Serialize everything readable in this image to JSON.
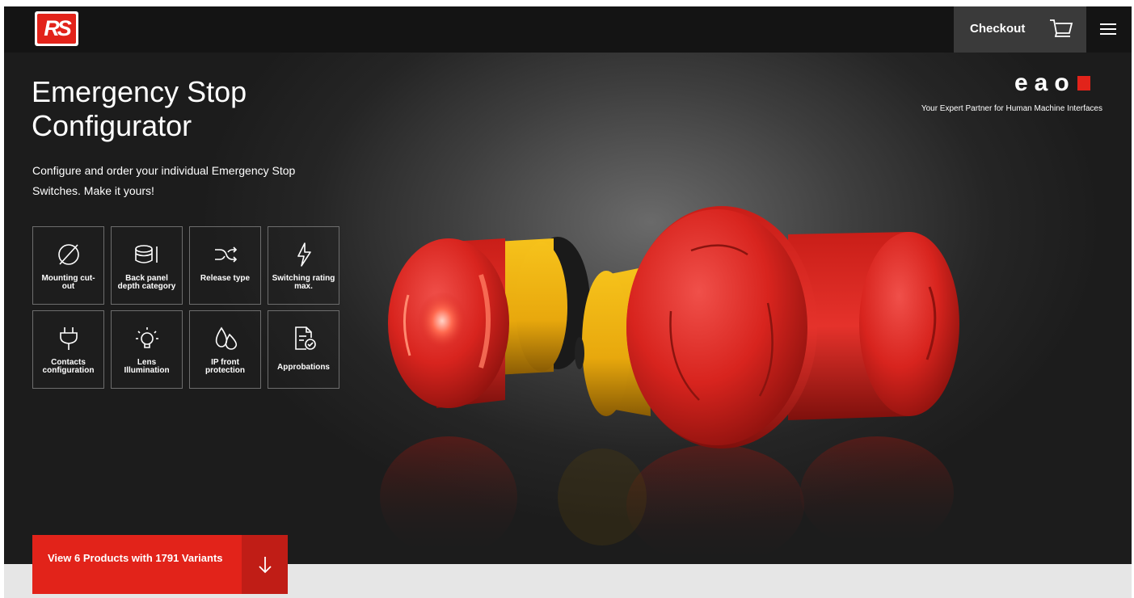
{
  "header": {
    "logo_text": "RS",
    "checkout_label": "Checkout",
    "icons": [
      "cart-icon",
      "hamburger-menu-icon"
    ]
  },
  "hero": {
    "title_line1": "Emergency Stop",
    "title_line2": "Configurator",
    "subtitle": "Configure and order your individual Emergency Stop Switches. Make it yours!",
    "features": [
      {
        "label": "Mounting cut-out",
        "icon": "diameter-icon"
      },
      {
        "label": "Back panel depth category",
        "icon": "cylinder-depth-icon"
      },
      {
        "label": "Release type",
        "icon": "shuffle-icon"
      },
      {
        "label": "Switching rating max.",
        "icon": "lightning-icon"
      },
      {
        "label": "Contacts configuration",
        "icon": "plug-icon"
      },
      {
        "label": "Lens Illumination",
        "icon": "lightbulb-icon"
      },
      {
        "label": "IP front protection",
        "icon": "water-drops-icon"
      },
      {
        "label": "Approbations",
        "icon": "certificate-icon"
      }
    ]
  },
  "brand": {
    "name": "eao",
    "tagline": "Your Expert Partner for Human Machine Interfaces",
    "accent_color": "#e2231a"
  },
  "cta": {
    "label": "View 6 Products with 1791 Variants",
    "icon": "arrow-down-icon"
  }
}
